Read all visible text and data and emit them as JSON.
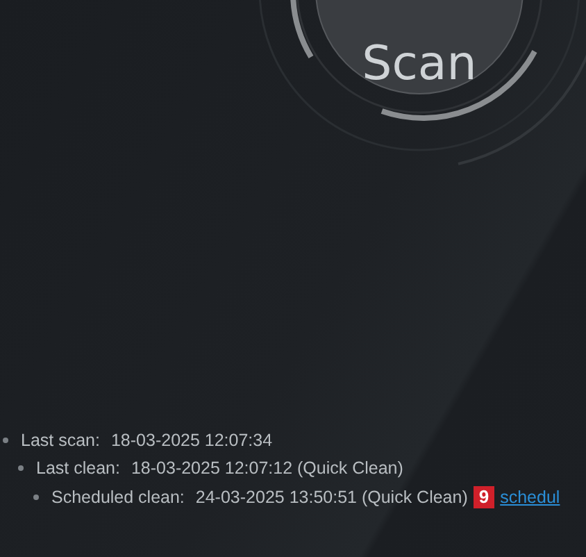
{
  "scan_button": {
    "label": "Scan"
  },
  "history": [
    {
      "label": "Last scan:",
      "value": "18-03-2025 12:07:34"
    },
    {
      "label": "Last clean:",
      "value": "18-03-2025 12:07:12 (Quick Clean)"
    },
    {
      "label": "Scheduled clean:",
      "value": "24-03-2025 13:50:51 (Quick Clean)",
      "badge": "9",
      "link": "schedul"
    }
  ]
}
